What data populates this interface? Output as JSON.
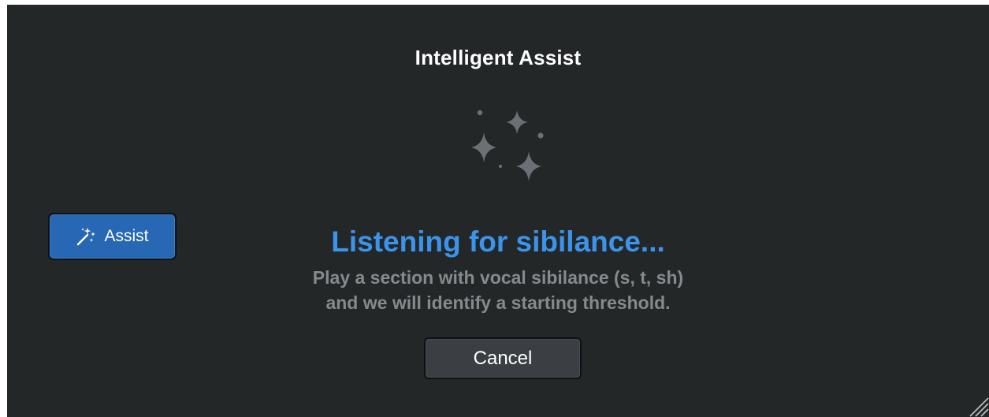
{
  "dialog": {
    "title": "Intelligent Assist",
    "status_heading": "Listening for sibilance...",
    "description_line1": "Play a section with vocal sibilance (s, t, sh)",
    "description_line2": "and we will identify a starting threshold.",
    "cancel_label": "Cancel"
  },
  "assist_button": {
    "label": "Assist",
    "icon": "magic-wand-icon"
  },
  "icons": {
    "status": "sparkles-icon",
    "corner": "resize-grip-icon"
  },
  "colors": {
    "panel_background": "#232728",
    "accent_blue": "#3b94ea",
    "assist_button_blue": "#2767b4",
    "description_gray": "#858a8e",
    "sparkle_gray": "#6b7075"
  }
}
